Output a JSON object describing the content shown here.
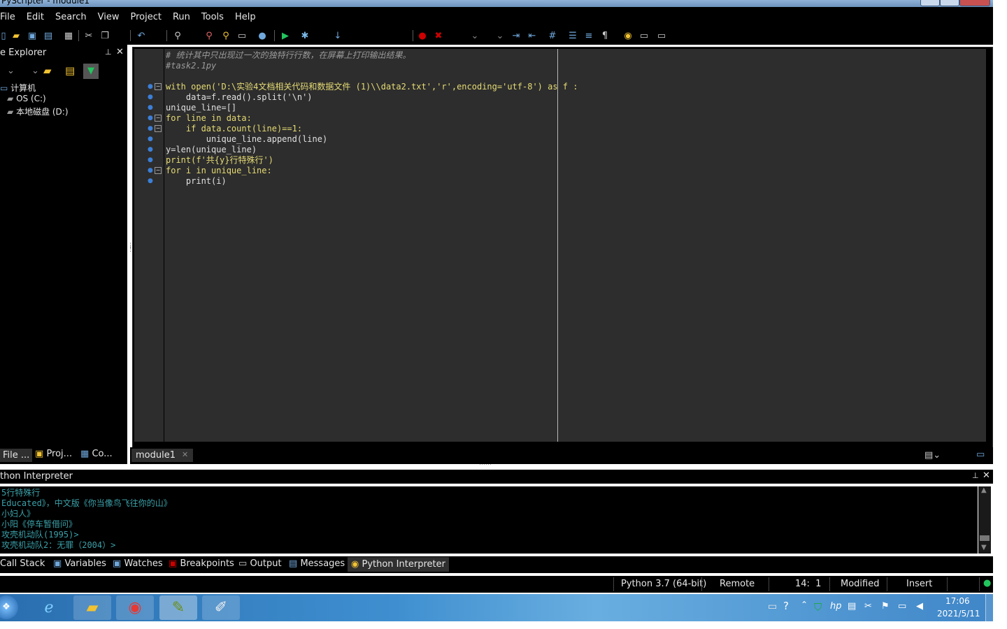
{
  "window": {
    "title": "PyScripter - module1"
  },
  "menu": [
    "File",
    "Edit",
    "Search",
    "View",
    "Project",
    "Run",
    "Tools",
    "Help"
  ],
  "colors": {
    "background": "#000000",
    "editor_bg": "#2d2d2d",
    "comment": "#9a9a9a",
    "keyword": "#e6db74",
    "output": "#3aa0a8",
    "taskbar": "#3f8fd0"
  },
  "explorer": {
    "title": "e Explorer",
    "tree": [
      {
        "label": "计算机",
        "icon": "computer-icon"
      },
      {
        "label": "OS (C:)",
        "icon": "drive-icon"
      },
      {
        "label": "本地磁盘 (D:)",
        "icon": "drive-icon"
      }
    ],
    "tabs": [
      "File ...",
      "Proj...",
      "Co..."
    ]
  },
  "editor": {
    "tab": "module1",
    "lines": [
      "# 统计其中只出现过一次的独特行行数，在屏幕上打印输出结果。",
      "#task2.1py",
      "",
      "with open('D:\\实验4文档相关代码和数据文件 (1)\\\\data2.txt','r',encoding='utf-8') as f :",
      "    data=f.read().split('\\n')",
      "unique_line=[]",
      "for line in data:",
      "    if data.count(line)==1:",
      "        unique_line.append(line)",
      "y=len(unique_line)",
      "print(f'共{y}行特殊行')",
      "for i in unique_line:",
      "    print(i)"
    ]
  },
  "interpreter": {
    "title": "thon Interpreter",
    "output": [
      "5行特殊行",
      "Educated》，中文版《你当像鸟飞往你的山》",
      "小妇人》",
      "小阳《停车暂借问》",
      "攻壳机动队(1995)>",
      "攻壳机动队2：无罪（2004）>"
    ]
  },
  "bottom_tabs": [
    "Call Stack",
    "Variables",
    "Watches",
    "Breakpoints",
    "Output",
    "Messages",
    "Python Interpreter"
  ],
  "status": {
    "python": "Python 3.7 (64-bit)",
    "engine": "Remote",
    "position": "14:  1",
    "modified": "Modified",
    "mode": "Insert"
  },
  "clock": {
    "time": "17:06",
    "date": "2021/5/11"
  }
}
